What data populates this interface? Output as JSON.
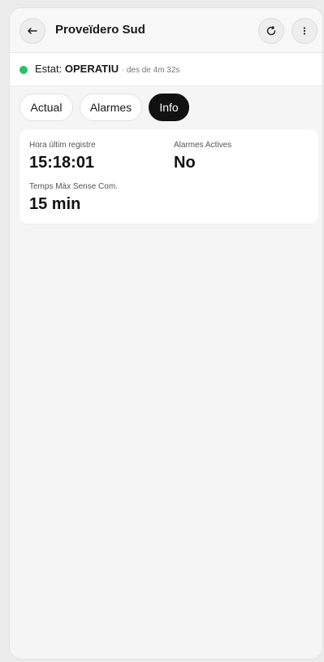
{
  "header": {
    "title": "Proveïdero Sud",
    "back_icon": "arrow-left-icon",
    "refresh_icon": "refresh-icon",
    "menu_icon": "more-vertical-icon"
  },
  "status": {
    "label": "Estat:",
    "value": "OPERATIU",
    "since": "· des de 4m 32s",
    "color": "#22c55e"
  },
  "tabs": [
    {
      "label": "Actual",
      "active": false
    },
    {
      "label": "Alarmes",
      "active": false
    },
    {
      "label": "Info",
      "active": true
    }
  ],
  "info": {
    "last_record_label": "Hora últim registre",
    "last_record_value": "15:18:01",
    "active_alarms_label": "Alarmes Actives",
    "active_alarms_value": "No",
    "max_no_comm_label": "Temps Màx Sense Com.",
    "max_no_comm_value": "15 min"
  },
  "colors": {
    "active_tab_bg": "#111111",
    "background": "#f5f5f5"
  }
}
